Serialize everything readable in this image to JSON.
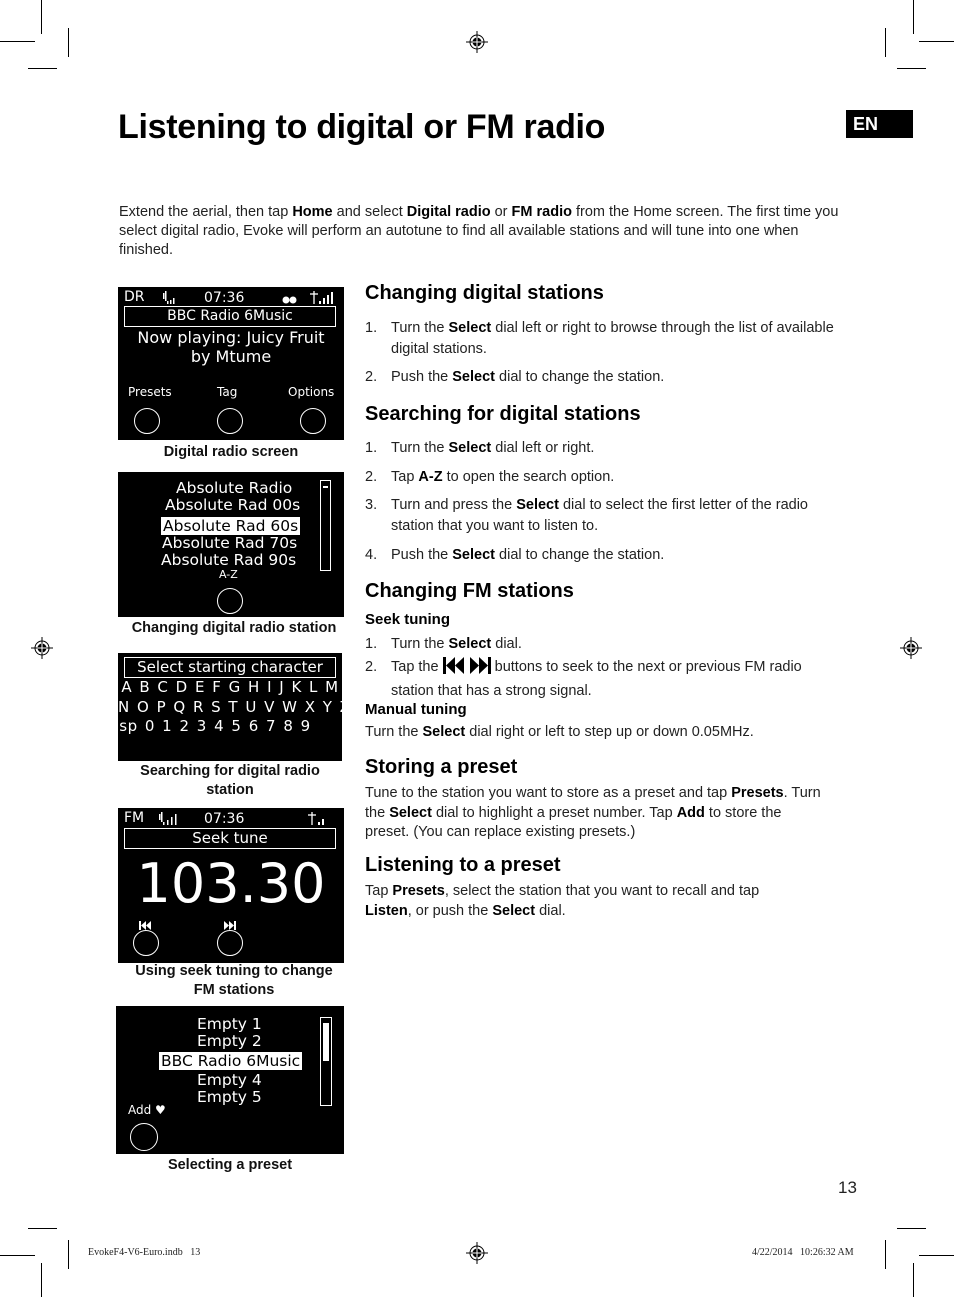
{
  "page": {
    "title": "Listening to digital or FM radio",
    "language_badge": "EN",
    "page_number": "13",
    "intro": {
      "t1": "Extend the aerial, then tap ",
      "b1": "Home",
      "t2": " and select ",
      "b2": "Digital radio",
      "t3": " or ",
      "b3": "FM radio",
      "t4": " from the Home screen. The first time you select digital radio, Evoke will perform an autotune to find all available stations and will tune into one when finished."
    },
    "footer": {
      "file": "EvokeF4-V6-Euro.indb   13",
      "timestamp": "4/22/2014   10:26:32 AM"
    }
  },
  "screens": {
    "digital": {
      "mode": "DR",
      "time": "07:36",
      "station": "BBC Radio 6Music",
      "now_playing_1": "Now playing: Juicy Fruit",
      "now_playing_2": "by Mtume",
      "softkeys": [
        "Presets",
        "Tag",
        "Options"
      ],
      "icons": [
        "speaker-volume-icon",
        "battery-dots-icon",
        "antenna-signal-icon"
      ],
      "caption": "Digital radio screen"
    },
    "station_list": {
      "items": [
        "Absolute Radio",
        "Absolute Rad 00s",
        "Absolute Rad 60s",
        "Absolute Rad 70s",
        "Absolute Rad 90s"
      ],
      "selected_index": 2,
      "softkey": "A-Z",
      "caption": "Changing digital radio station"
    },
    "search": {
      "header": "Select starting character",
      "rows": [
        "A B C D E F G H I J K L M",
        "N O P Q R S T U V W X Y Z",
        "sp 0 1 2 3 4 5 6 7 8 9"
      ],
      "caption_1": "Searching for digital radio",
      "caption_2": "station"
    },
    "fm": {
      "mode": "FM",
      "time": "07:36",
      "header": "Seek tune",
      "frequency": "103.30",
      "softkeys": [
        "seek-back-icon",
        "seek-forward-icon"
      ],
      "caption_1": "Using seek tuning to change",
      "caption_2": "FM stations"
    },
    "presets": {
      "items": [
        "Empty 1",
        "Empty 2",
        "BBC Radio 6Music",
        "Empty 4",
        "Empty 5"
      ],
      "selected_index": 2,
      "softkey": "Add ♥",
      "caption": "Selecting a preset"
    }
  },
  "sections": {
    "changing_digital": {
      "heading": "Changing digital stations",
      "steps": [
        {
          "num": "1.",
          "t1": "Turn the ",
          "b": "Select",
          "t2": " dial left or right to browse through the list of available digital stations."
        },
        {
          "num": "2.",
          "t1": "Push the ",
          "b": "Select",
          "t2": " dial to change the station."
        }
      ]
    },
    "searching_digital": {
      "heading": "Searching for digital stations",
      "steps": [
        {
          "num": "1.",
          "t1": "Turn the ",
          "b": "Select",
          "t2": " dial left or right."
        },
        {
          "num": "2.",
          "t1": "Tap ",
          "b": "A-Z",
          "t2": " to open the search option."
        },
        {
          "num": "3.",
          "t1": "Turn and press the ",
          "b": "Select",
          "t2": " dial to select the first letter of the radio station that you want to listen to."
        },
        {
          "num": "4.",
          "t1": "Push the ",
          "b": "Select",
          "t2": " dial to change the station."
        }
      ]
    },
    "changing_fm": {
      "heading": "Changing FM stations",
      "seek_heading": "Seek tuning",
      "seek_steps": [
        {
          "num": "1.",
          "t1": "Turn the ",
          "b": "Select",
          "t2": " dial."
        },
        {
          "num": "2.",
          "t1": "Tap the ",
          "t2": " buttons to seek to the next or previous FM radio station that has a strong signal."
        }
      ],
      "manual_heading": "Manual tuning",
      "manual": {
        "t1": "Turn the ",
        "b": "Select",
        "t2": " dial right or left to step up or down 0.05MHz."
      }
    },
    "storing": {
      "heading": "Storing a preset",
      "t1": "Tune to the station you want to store as a preset and tap ",
      "b1": "Presets",
      "t2": ". Turn the ",
      "b2": "Select",
      "t3": " dial to highlight a preset number. Tap ",
      "b3": "Add",
      "t4": " to store the preset. (You can replace existing presets.)"
    },
    "listening": {
      "heading": "Listening to a preset",
      "t1": "Tap ",
      "b1": "Presets",
      "t2": ", select the station that you want to recall and tap ",
      "b2": "Listen",
      "t3": ", or push the ",
      "b3": "Select",
      "t4": " dial."
    }
  }
}
